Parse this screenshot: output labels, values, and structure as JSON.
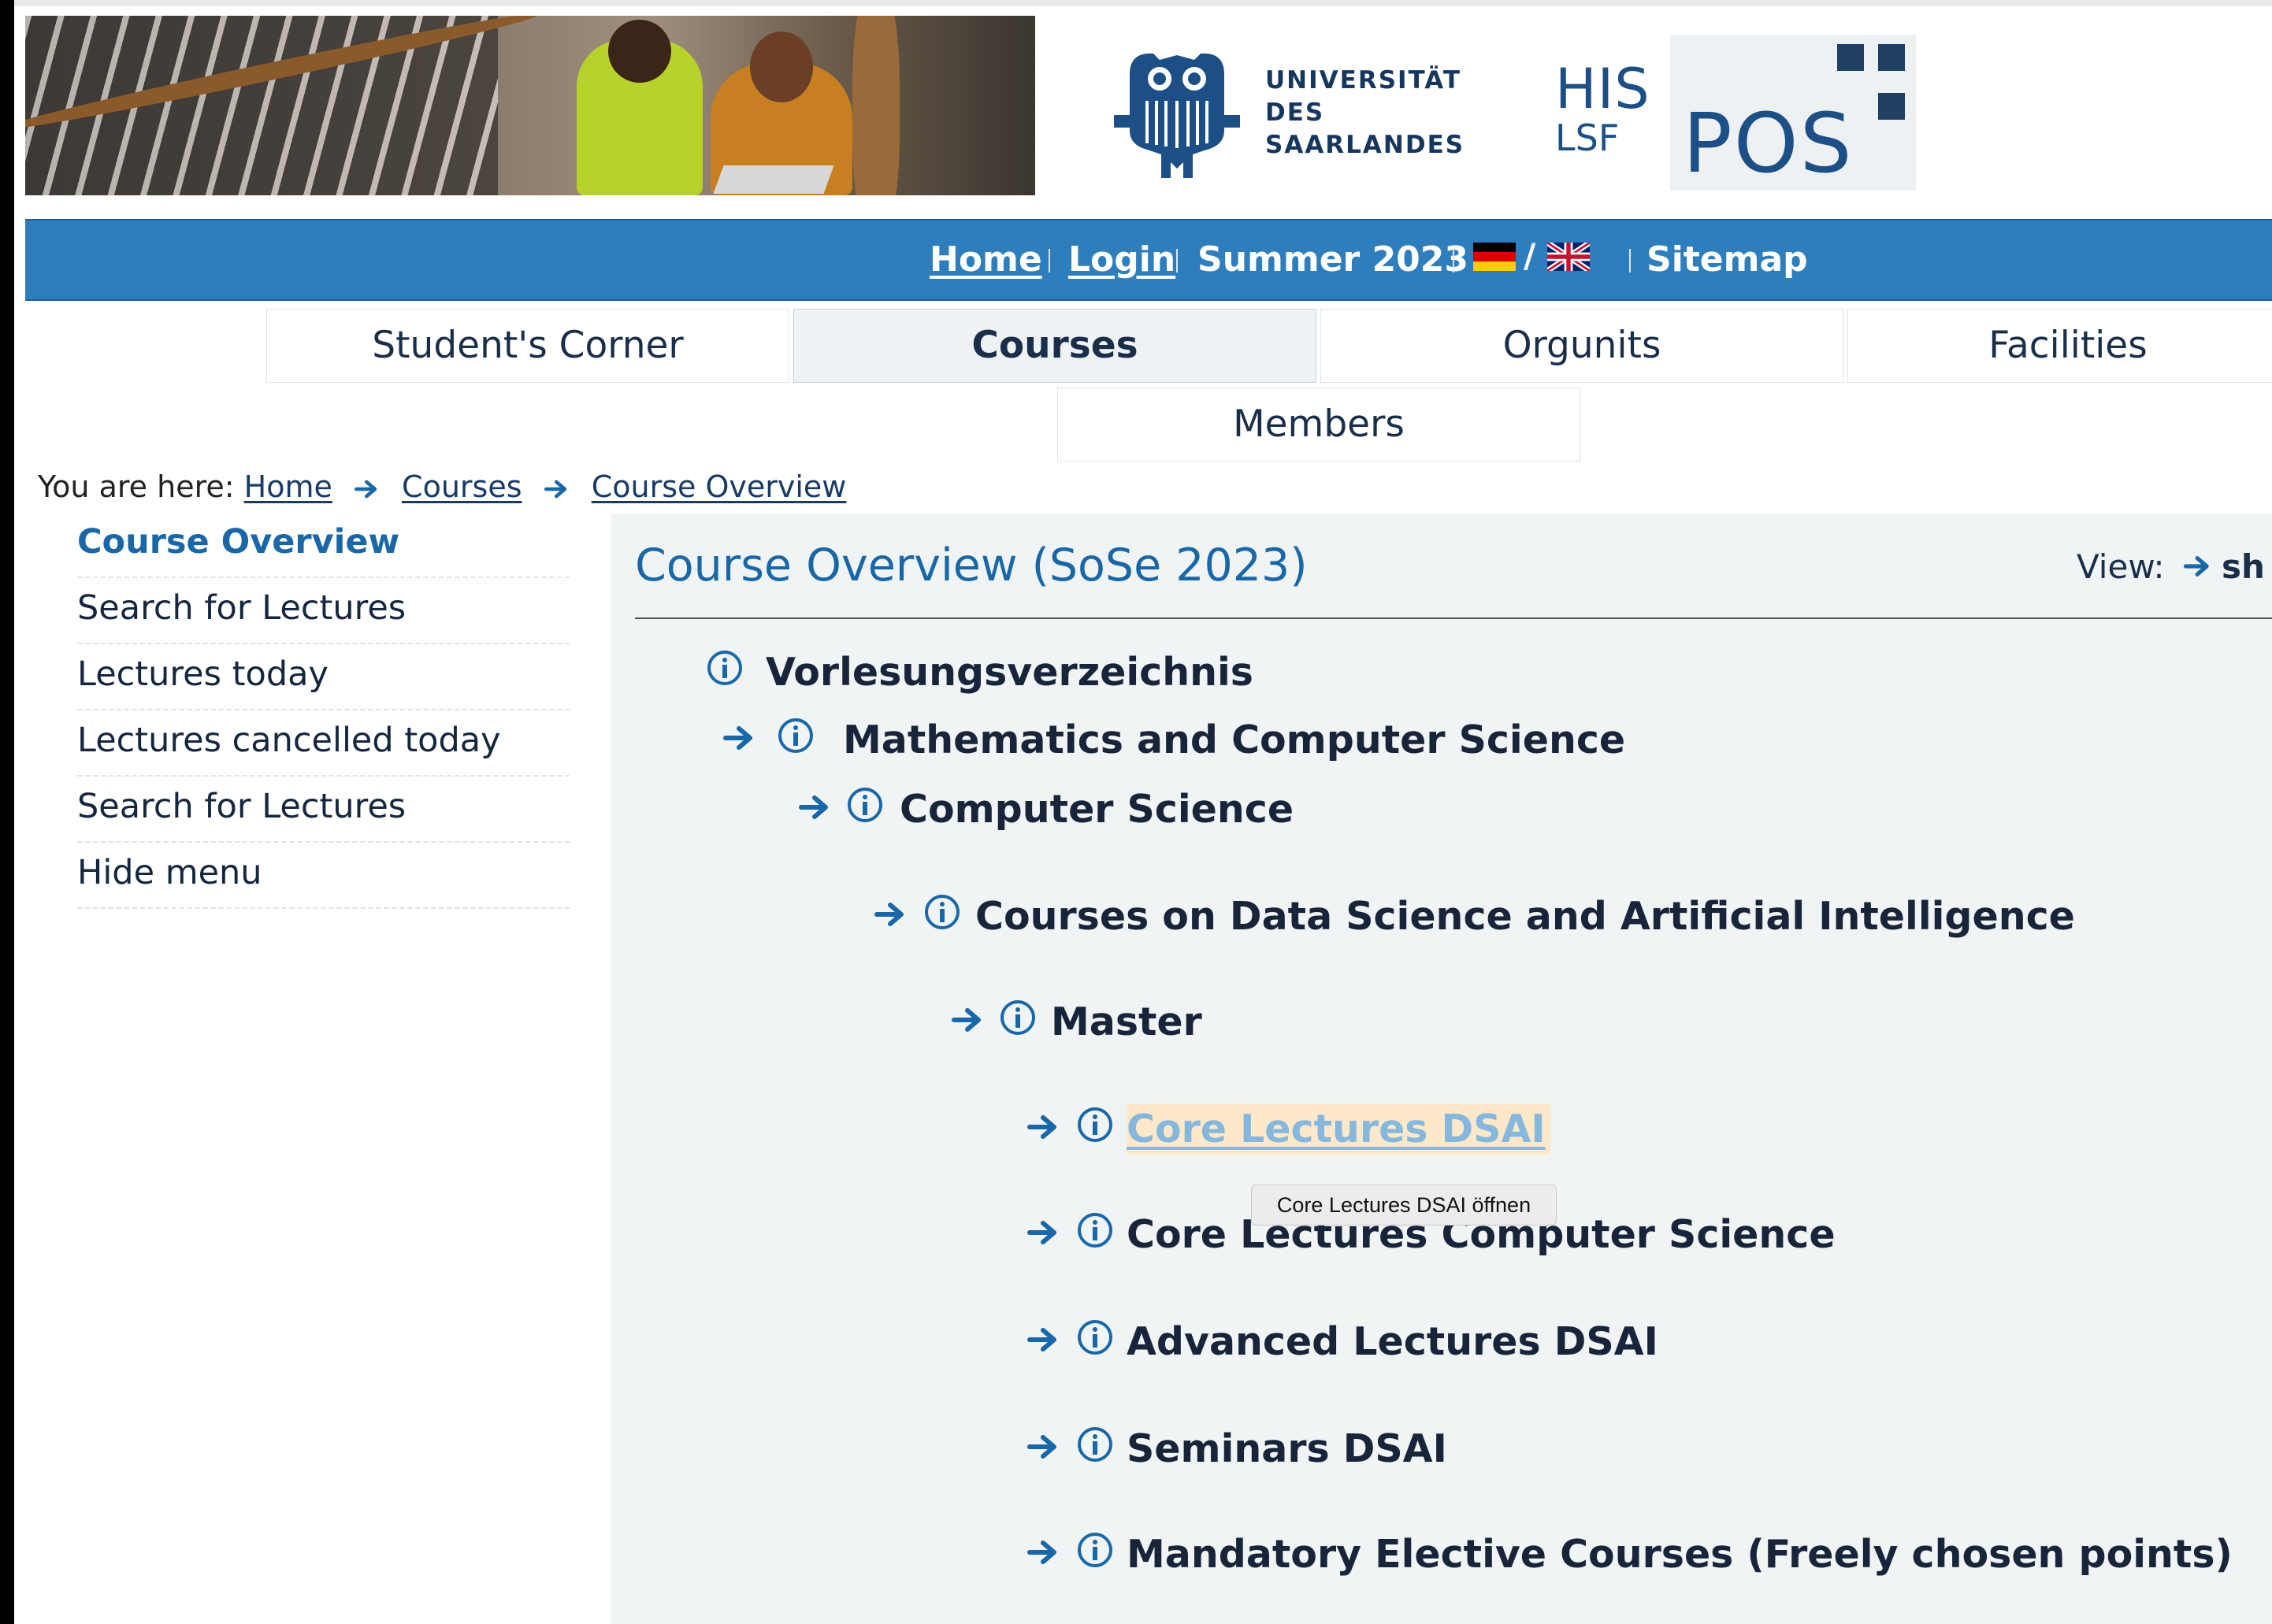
{
  "header": {
    "university_lines": [
      "UNIVERSITÄT",
      "DES",
      "SAARLANDES"
    ],
    "his_top": "HIS",
    "his_bottom": "LSF",
    "pos": "POS"
  },
  "navbar": {
    "home": "Home",
    "login": "Login",
    "semester": "Summer 2023",
    "language_separator": "/",
    "sitemap": "Sitemap",
    "color": "#2e7ebd"
  },
  "tabs": [
    {
      "label": "Student's Corner",
      "active": false
    },
    {
      "label": "Courses",
      "active": true
    },
    {
      "label": "Orgunits",
      "active": false
    },
    {
      "label": "Facilities",
      "active": false
    },
    {
      "label": "Members",
      "active": false
    }
  ],
  "breadcrumb": {
    "prefix": "You are here:",
    "items": [
      "Home",
      "Courses",
      "Course Overview"
    ]
  },
  "left_menu": {
    "items": [
      {
        "label": "Course Overview",
        "active": true
      },
      {
        "label": "Search for Lectures",
        "active": false
      },
      {
        "label": "Lectures today",
        "active": false
      },
      {
        "label": "Lectures cancelled today",
        "active": false
      },
      {
        "label": "Search for Lectures",
        "active": false
      },
      {
        "label": "Hide menu",
        "active": false
      }
    ]
  },
  "main": {
    "title": "Course Overview (SoSe 2023)",
    "view_label": "View:",
    "view_option": "sh",
    "tree": [
      {
        "label": "Vorlesungsverzeichnis",
        "level": 0
      },
      {
        "label": "Mathematics and Computer Science",
        "level": 1
      },
      {
        "label": "Computer Science",
        "level": 2
      },
      {
        "label": "Courses on Data Science and Artificial Intelligence",
        "level": 3
      },
      {
        "label": "Master",
        "level": 4
      },
      {
        "label": "Core Lectures DSAI",
        "level": 5,
        "hovered": true
      },
      {
        "label": "Core Lectures Computer Science",
        "level": 5
      },
      {
        "label": "Advanced Lectures DSAI",
        "level": 5
      },
      {
        "label": "Seminars DSAI",
        "level": 5
      },
      {
        "label": "Mandatory Elective Courses (Freely chosen points)",
        "level": 5
      }
    ],
    "tooltip": "Core Lectures DSAI öffnen"
  },
  "colors": {
    "accent": "#1a67a8",
    "content_bg": "#f0f4f4",
    "hover_bg": "#fde9c9",
    "hover_text": "#86b7dd"
  }
}
